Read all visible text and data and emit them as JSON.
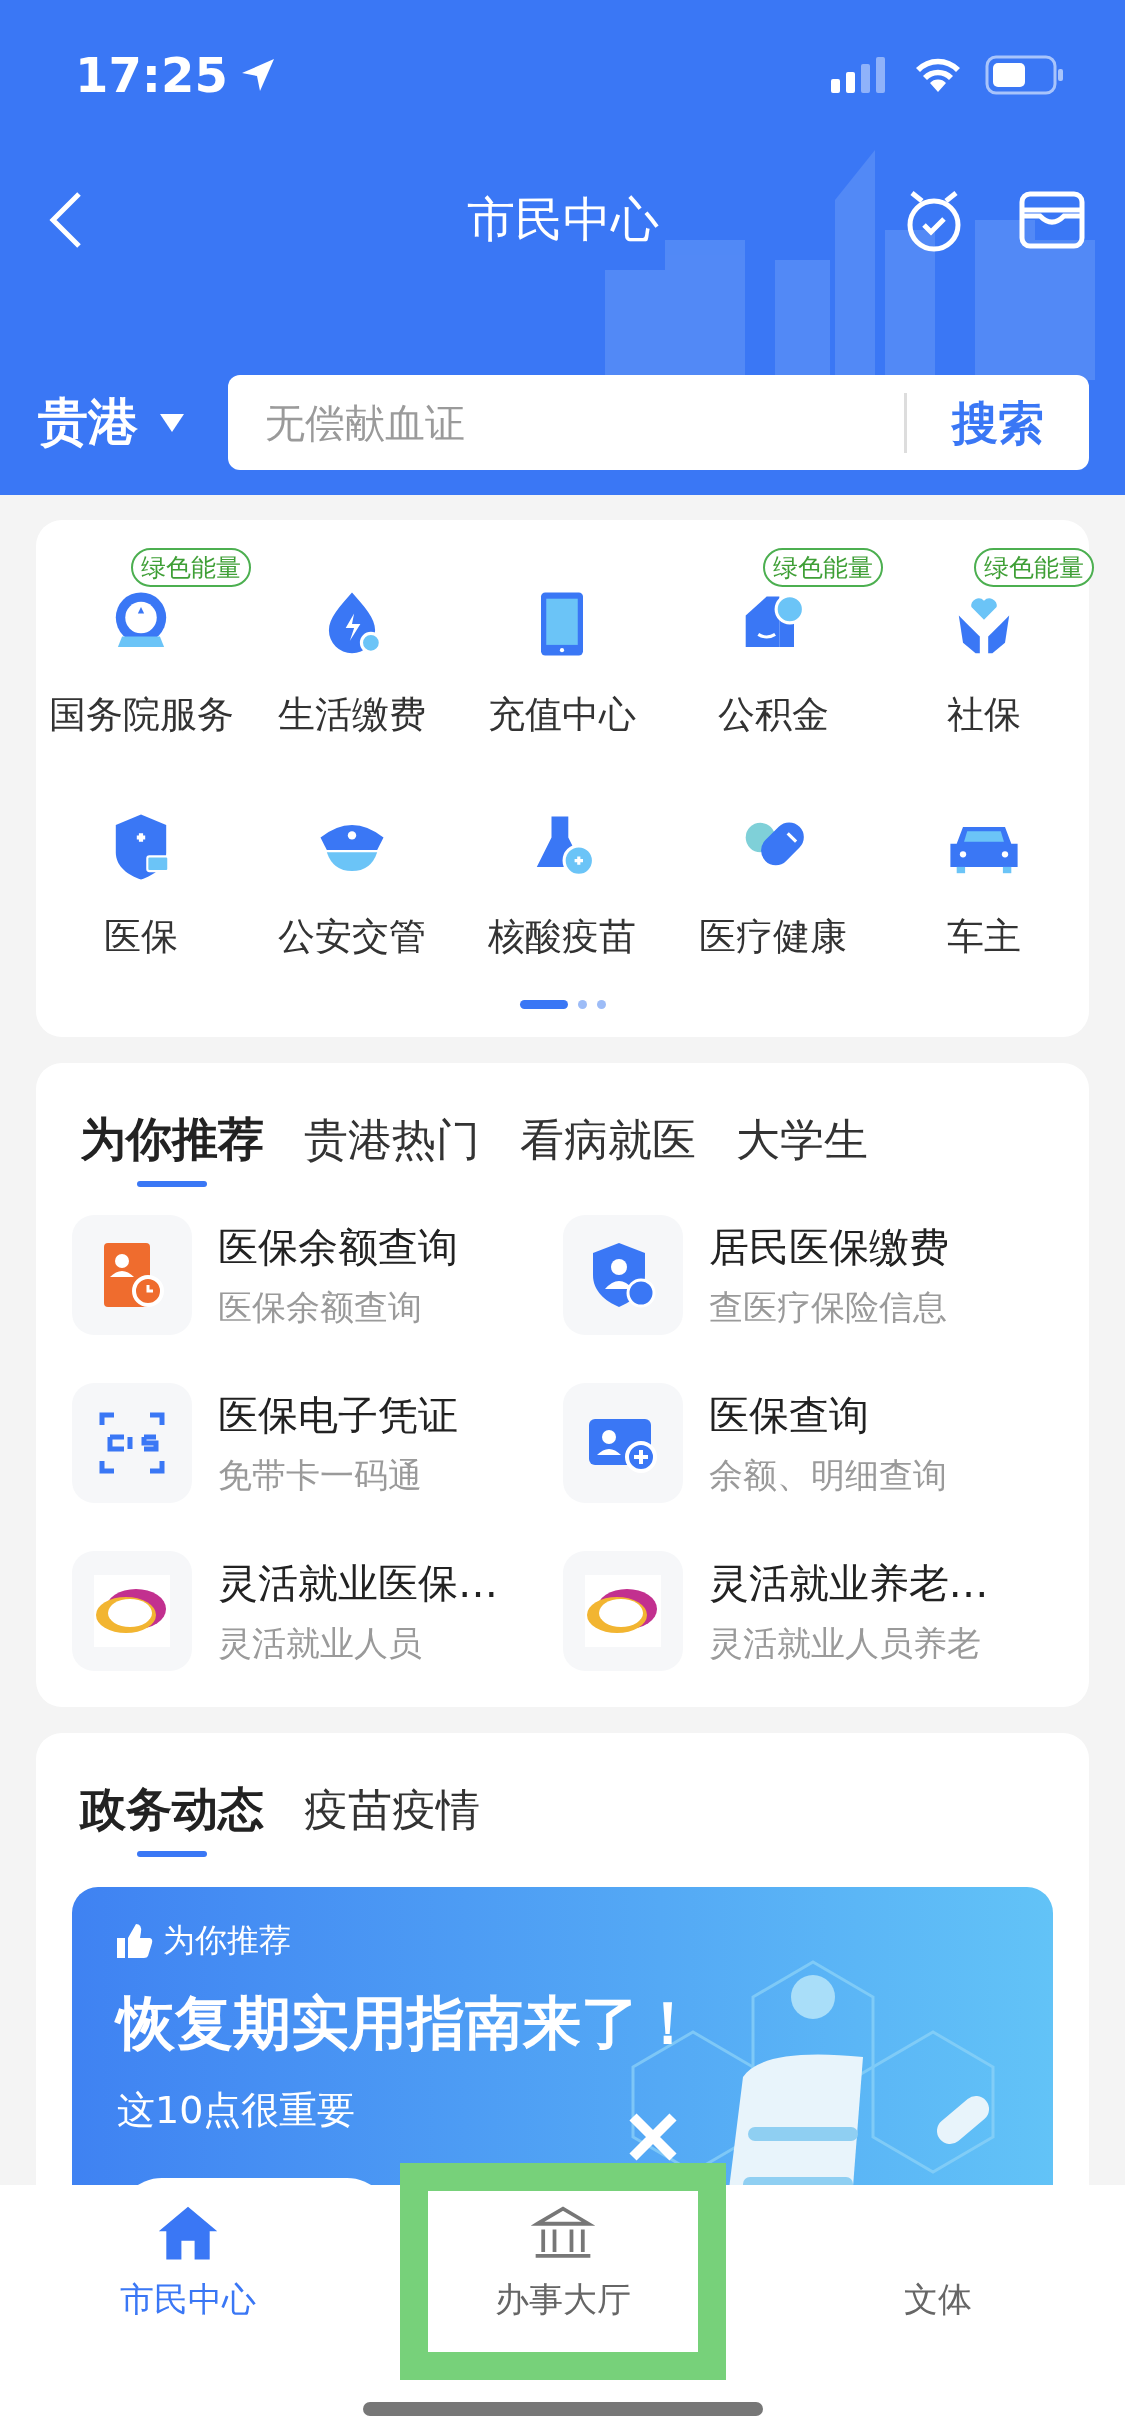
{
  "status_bar": {
    "time": "17:25"
  },
  "header": {
    "title": "市民中心",
    "city": "贵港",
    "search": {
      "placeholder": "无偿献血证",
      "button": "搜索"
    }
  },
  "services": {
    "items": [
      {
        "label": "国务院服务",
        "badge": "绿色能量"
      },
      {
        "label": "生活缴费"
      },
      {
        "label": "充值中心"
      },
      {
        "label": "公积金",
        "badge": "绿色能量"
      },
      {
        "label": "社保",
        "badge": "绿色能量"
      },
      {
        "label": "医保"
      },
      {
        "label": "公安交管"
      },
      {
        "label": "核酸疫苗"
      },
      {
        "label": "医疗健康"
      },
      {
        "label": "车主"
      }
    ],
    "pages": [
      {
        "selected": true
      },
      {
        "selected": false
      },
      {
        "selected": false
      }
    ]
  },
  "recommend": {
    "tabs": [
      {
        "label": "为你推荐",
        "selected": true
      },
      {
        "label": "贵港热门",
        "selected": false
      },
      {
        "label": "看病就医",
        "selected": false
      },
      {
        "label": "大学生",
        "selected": false
      }
    ],
    "items": [
      {
        "title": "医保余额查询",
        "subtitle": "医保余额查询"
      },
      {
        "title": "居民医保缴费",
        "subtitle": "查医疗保险信息"
      },
      {
        "title": "医保电子凭证",
        "subtitle": "免带卡一码通"
      },
      {
        "title": "医保查询",
        "subtitle": "余额、明细查询"
      },
      {
        "title": "灵活就业医保…",
        "subtitle": "灵活就业人员"
      },
      {
        "title": "灵活就业养老…",
        "subtitle": "灵活就业人员养老"
      }
    ]
  },
  "news": {
    "tabs": [
      {
        "label": "政务动态",
        "selected": true
      },
      {
        "label": "疫苗疫情",
        "selected": false
      }
    ],
    "banner": {
      "tag": "为你推荐",
      "title": "恢复期实用指南来了！",
      "subtitle": "这10点很重要"
    }
  },
  "tab_bar": [
    {
      "label": "市民中心",
      "selected": true,
      "highlighted": false
    },
    {
      "label": "办事大厅",
      "selected": false,
      "highlighted": true
    },
    {
      "label": "文体",
      "selected": false,
      "highlighted": false
    }
  ]
}
